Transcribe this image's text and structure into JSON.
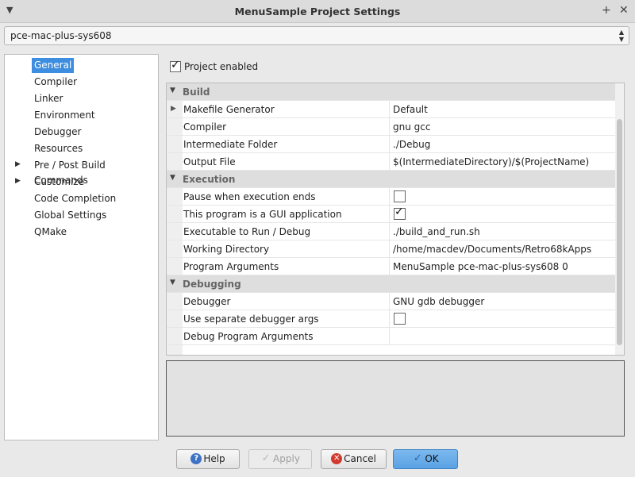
{
  "window": {
    "title": "MenuSample Project Settings"
  },
  "config": {
    "selected": "pce-mac-plus-sys608"
  },
  "sidebar": {
    "items": [
      {
        "label": "General",
        "selected": true,
        "expandable": false
      },
      {
        "label": "Compiler",
        "expandable": false
      },
      {
        "label": "Linker",
        "expandable": false
      },
      {
        "label": "Environment",
        "expandable": false
      },
      {
        "label": "Debugger",
        "expandable": false
      },
      {
        "label": "Resources",
        "expandable": false
      },
      {
        "label": "Pre / Post Build Commands",
        "expandable": true
      },
      {
        "label": "Customize",
        "expandable": true
      },
      {
        "label": "Code Completion",
        "expandable": false
      },
      {
        "label": "Global Settings",
        "expandable": false
      },
      {
        "label": "QMake",
        "expandable": false
      }
    ]
  },
  "project_enabled": {
    "label": "Project enabled",
    "checked": true
  },
  "grid": {
    "build": {
      "title": "Build",
      "rows": [
        {
          "name": "Makefile Generator",
          "value": "Default"
        },
        {
          "name": "Compiler",
          "value": "gnu gcc"
        },
        {
          "name": "Intermediate Folder",
          "value": "./Debug"
        },
        {
          "name": "Output File",
          "value": "$(IntermediateDirectory)/$(ProjectName)"
        }
      ]
    },
    "execution": {
      "title": "Execution",
      "rows": [
        {
          "name": "Pause when execution ends",
          "checked": false
        },
        {
          "name": "This program is a GUI application",
          "checked": true
        },
        {
          "name": "Executable to Run / Debug",
          "value": "./build_and_run.sh"
        },
        {
          "name": "Working Directory",
          "value": "/home/macdev/Documents/Retro68kApps"
        },
        {
          "name": "Program Arguments",
          "value": "MenuSample pce-mac-plus-sys608 0"
        }
      ]
    },
    "debugging": {
      "title": "Debugging",
      "rows": [
        {
          "name": "Debugger",
          "value": "GNU gdb debugger"
        },
        {
          "name": "Use separate debugger args",
          "checked": false
        },
        {
          "name": "Debug Program Arguments",
          "value": ""
        }
      ]
    }
  },
  "buttons": {
    "help": "Help",
    "apply": "Apply",
    "cancel": "Cancel",
    "ok": "OK"
  },
  "colors": {
    "accent": "#3d8ee0",
    "ok_button": "#5aa2e4"
  }
}
